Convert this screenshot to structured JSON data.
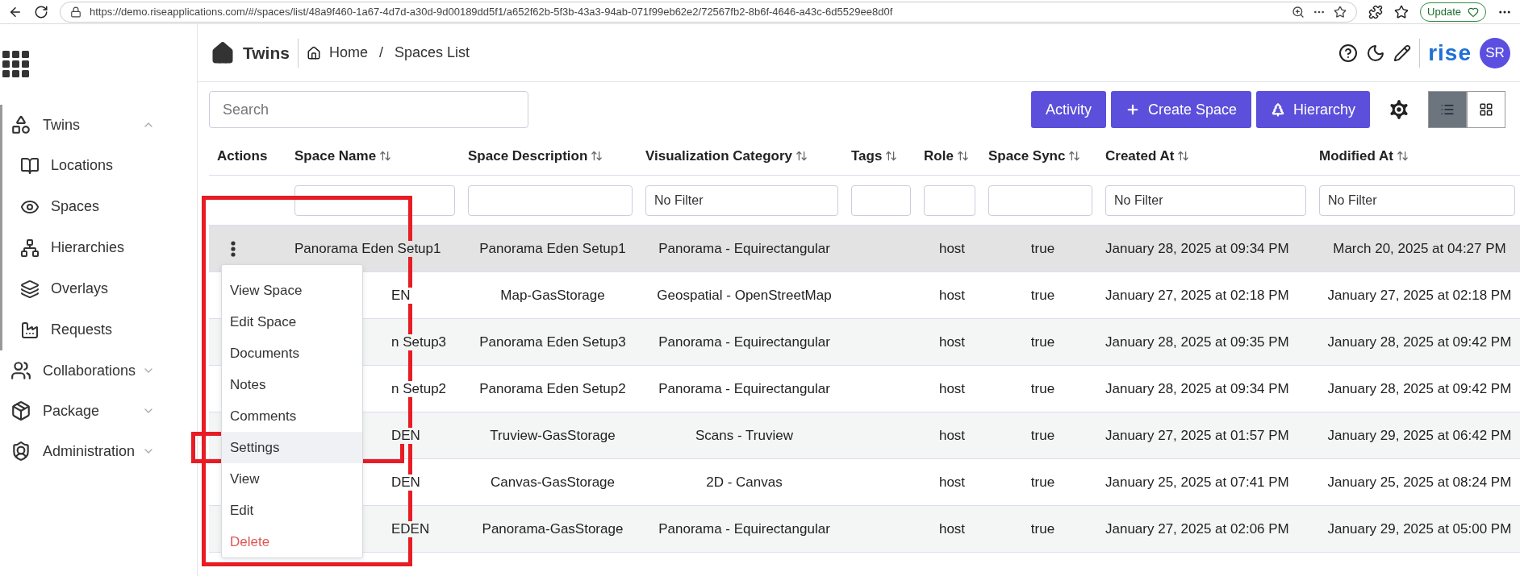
{
  "browser": {
    "url": "https://demo.riseapplications.com/#/spaces/list/48a9f460-1a67-4d7d-a30d-9d00189dd5f1/a652f62b-5f3b-43a3-94ab-071f99eb62e2/72567fb2-8b6f-4646-a43c-6d5529ee8d0f",
    "update_button": "Update"
  },
  "header": {
    "app_title": "Twins",
    "breadcrumb": [
      "Home",
      "Spaces List"
    ],
    "separator": "/",
    "logo": "rise",
    "avatar": "SR"
  },
  "sidebar": {
    "items": [
      {
        "label": "Twins",
        "expanded": true,
        "children": [
          {
            "label": "Locations"
          },
          {
            "label": "Spaces"
          },
          {
            "label": "Hierarchies"
          },
          {
            "label": "Overlays"
          },
          {
            "label": "Requests"
          }
        ]
      },
      {
        "label": "Collaborations",
        "expanded": false
      },
      {
        "label": "Package",
        "expanded": false
      },
      {
        "label": "Administration",
        "expanded": false
      }
    ]
  },
  "toolbar": {
    "search": {
      "placeholder": "Search"
    },
    "buttons": [
      "Activity",
      "Create Space",
      "Hierarchy"
    ],
    "views": [
      {
        "kind": "list",
        "selected": true
      },
      {
        "kind": "grid",
        "selected": false
      }
    ]
  },
  "table": {
    "columns": [
      {
        "label": "Actions",
        "sortable": false
      },
      {
        "label": "Space Name",
        "sortable": true
      },
      {
        "label": "Space Description",
        "sortable": true
      },
      {
        "label": "Visualization Category",
        "sortable": true
      },
      {
        "label": "Tags",
        "sortable": true
      },
      {
        "label": "Role",
        "sortable": true
      },
      {
        "label": "Space Sync",
        "sortable": true
      },
      {
        "label": "Created At",
        "sortable": true
      },
      {
        "label": "Modified At",
        "sortable": true
      }
    ],
    "filters": [
      {
        "kind": "none"
      },
      {
        "kind": "text"
      },
      {
        "kind": "text"
      },
      {
        "kind": "select",
        "placeholder": "No Filter"
      },
      {
        "kind": "text"
      },
      {
        "kind": "text"
      },
      {
        "kind": "text"
      },
      {
        "kind": "select",
        "placeholder": "No Filter"
      },
      {
        "kind": "select",
        "placeholder": "No Filter"
      }
    ],
    "rows": [
      {
        "name": "Panorama Eden Setup1",
        "partial": false,
        "hovered": true,
        "description": "Panorama Eden Setup1",
        "category": "Panorama - Equirectangular",
        "role": "host",
        "sync": "true",
        "created": "January 28, 2025 at 09:34 PM",
        "modified": "March 20, 2025 at 04:27 PM"
      },
      {
        "name": "EN",
        "partial": true,
        "hovered": false,
        "description": "Map-GasStorage",
        "category": "Geospatial - OpenStreetMap",
        "role": "host",
        "sync": "true",
        "created": "January 27, 2025 at 02:18 PM",
        "modified": "January 27, 2025 at 02:18 PM"
      },
      {
        "name": "n Setup3",
        "partial": true,
        "hovered": false,
        "description": "Panorama Eden Setup3",
        "category": "Panorama - Equirectangular",
        "role": "host",
        "sync": "true",
        "created": "January 28, 2025 at 09:35 PM",
        "modified": "January 28, 2025 at 09:42 PM"
      },
      {
        "name": "n Setup2",
        "partial": true,
        "hovered": false,
        "description": "Panorama Eden Setup2",
        "category": "Panorama - Equirectangular",
        "role": "host",
        "sync": "true",
        "created": "January 28, 2025 at 09:34 PM",
        "modified": "January 28, 2025 at 09:42 PM"
      },
      {
        "name": "DEN",
        "partial": true,
        "hovered": false,
        "description": "Truview-GasStorage",
        "category": "Scans - Truview",
        "role": "host",
        "sync": "true",
        "created": "January 27, 2025 at 01:57 PM",
        "modified": "January 29, 2025 at 06:42 PM"
      },
      {
        "name": "DEN",
        "partial": true,
        "hovered": false,
        "description": "Canvas-GasStorage",
        "category": "2D - Canvas",
        "role": "host",
        "sync": "true",
        "created": "January 25, 2025 at 07:41 PM",
        "modified": "January 25, 2025 at 08:24 PM"
      },
      {
        "name": "EDEN",
        "partial": true,
        "hovered": false,
        "description": "Panorama-GasStorage",
        "category": "Panorama - Equirectangular",
        "role": "host",
        "sync": "true",
        "created": "January 27, 2025 at 02:06 PM",
        "modified": "January 29, 2025 at 05:00 PM"
      }
    ]
  },
  "action_menu": {
    "highlighted": true,
    "items": [
      {
        "label": "View Space",
        "kind": "normal",
        "selected": false,
        "highlighted": false
      },
      {
        "label": "Edit Space",
        "kind": "normal",
        "selected": false,
        "highlighted": false
      },
      {
        "label": "Documents",
        "kind": "normal",
        "selected": false,
        "highlighted": false
      },
      {
        "label": "Notes",
        "kind": "normal",
        "selected": false,
        "highlighted": false
      },
      {
        "label": "Comments",
        "kind": "normal",
        "selected": false,
        "highlighted": false
      },
      {
        "label": "Settings",
        "kind": "normal",
        "selected": true,
        "highlighted": true
      },
      {
        "label": "View",
        "kind": "normal",
        "selected": false,
        "highlighted": false
      },
      {
        "label": "Edit",
        "kind": "normal",
        "selected": false,
        "highlighted": false
      },
      {
        "label": "Delete",
        "kind": "danger",
        "selected": false,
        "highlighted": false
      }
    ]
  }
}
